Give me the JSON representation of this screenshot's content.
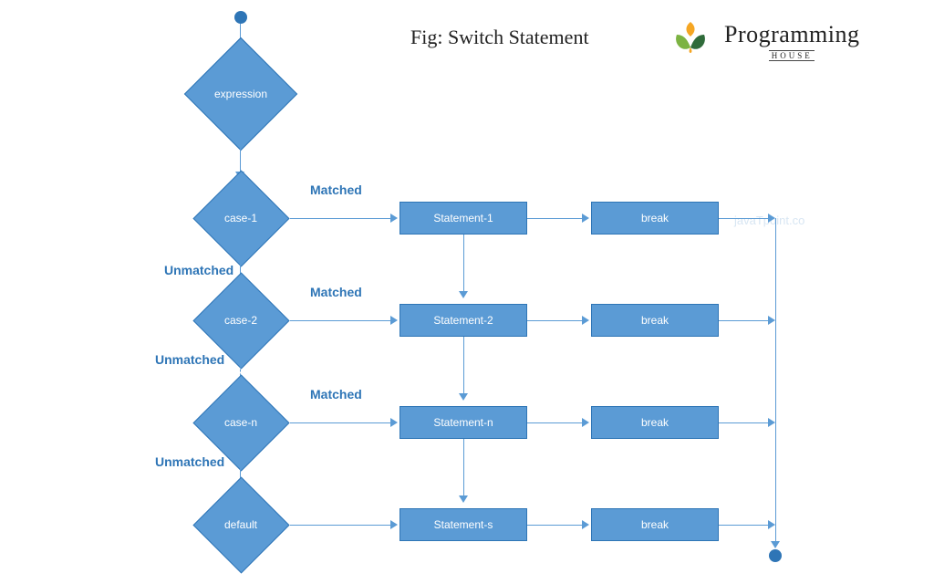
{
  "title": "Fig: Switch Statement",
  "logo": {
    "main": "Programming",
    "sub": "HOUSE"
  },
  "watermark": "javaTpoint.co",
  "nodes": {
    "expression": "expression",
    "case1": "case-1",
    "case2": "case-2",
    "casen": "case-n",
    "default": "default",
    "stmt1": "Statement-1",
    "stmt2": "Statement-2",
    "stmtn": "Statement-n",
    "stmts": "Statement-s",
    "break1": "break",
    "break2": "break",
    "breakn": "break",
    "breaks": "break"
  },
  "labels": {
    "matched": "Matched",
    "unmatched": "Unmatched"
  },
  "colors": {
    "shape_fill": "#5b9bd5",
    "shape_border": "#2e75b6",
    "label": "#2e75b6"
  }
}
